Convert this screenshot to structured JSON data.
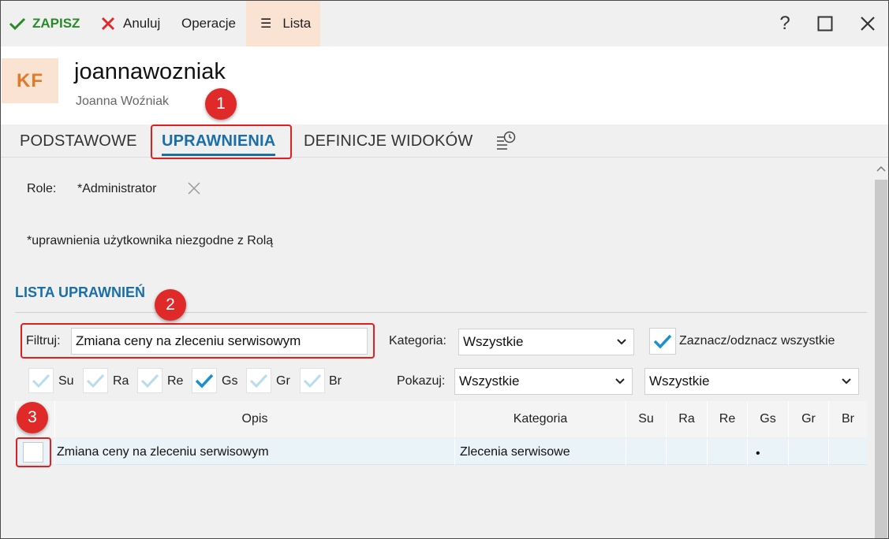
{
  "toolbar": {
    "save_label": "ZAPISZ",
    "cancel_label": "Anuluj",
    "operations_label": "Operacje",
    "list_label": "Lista",
    "help_label": "?"
  },
  "header": {
    "avatar_initials": "KF",
    "username": "joannawozniak",
    "full_name": "Joanna Woźniak"
  },
  "tabs": [
    {
      "label": "PODSTAWOWE",
      "active": false
    },
    {
      "label": "UPRAWNIENIA",
      "active": true
    },
    {
      "label": "DEFINICJE WIDOKÓW",
      "active": false
    }
  ],
  "roles": {
    "label": "Role:",
    "value": "*Administrator"
  },
  "note": "*uprawnienia użytkownika niezgodne z Rolą",
  "section_title": "LISTA UPRAWNIEŃ",
  "filter": {
    "label": "Filtruj:",
    "value": "Zmiana ceny na zleceniu serwisowym"
  },
  "category": {
    "label": "Kategoria:",
    "selected": "Wszystkie"
  },
  "check_all_label": "Zaznacz/odznacz wszystkie",
  "show": {
    "label": "Pokazuj:",
    "selected_1": "Wszystkie",
    "selected_2": "Wszystkie"
  },
  "permission_flags": [
    {
      "label": "Su",
      "checked": false
    },
    {
      "label": "Ra",
      "checked": false
    },
    {
      "label": "Re",
      "checked": false
    },
    {
      "label": "Gs",
      "checked": true
    },
    {
      "label": "Gr",
      "checked": false
    },
    {
      "label": "Br",
      "checked": false
    }
  ],
  "table": {
    "columns": [
      "Opis",
      "Kategoria",
      "Su",
      "Ra",
      "Re",
      "Gs",
      "Gr",
      "Br"
    ],
    "rows": [
      {
        "opis": "Zmiana ceny na zleceniu serwisowym",
        "kategoria": "Zlecenia serwisowe",
        "su": "",
        "ra": "",
        "re": "",
        "gs": "•",
        "gr": "",
        "br": ""
      }
    ]
  },
  "annotations": [
    "1",
    "2",
    "3"
  ],
  "colors": {
    "accent": "#1b6fa8",
    "save_green": "#2a8a2a",
    "cancel_red": "#e02a2a",
    "badge_red": "#e02a2a",
    "avatar_bg": "#fbe3d4",
    "avatar_text": "#e07a28"
  }
}
